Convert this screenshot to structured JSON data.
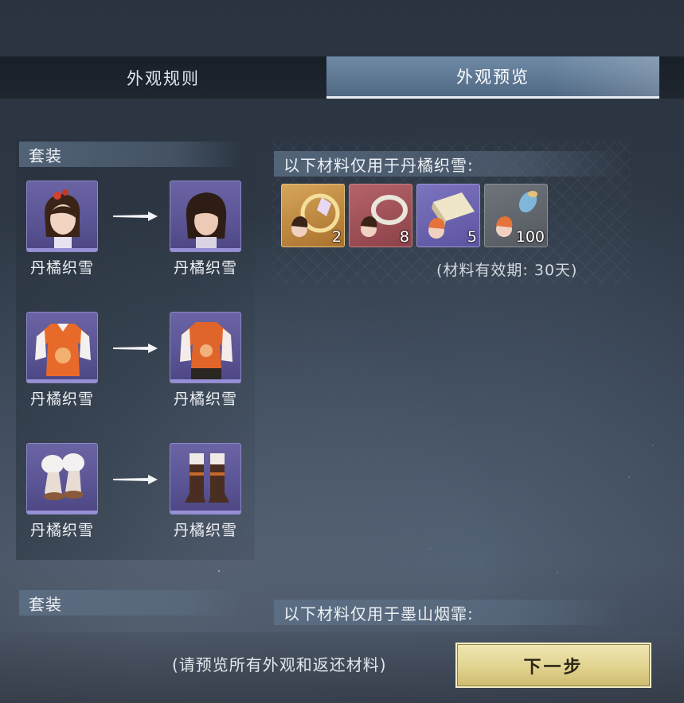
{
  "tabs": [
    {
      "label": "外观规则",
      "active": false
    },
    {
      "label": "外观预览",
      "active": true
    }
  ],
  "sections": [
    {
      "suit_header": "套装",
      "pairs": [
        {
          "from": {
            "icon": "hairstyle-icon",
            "label": "丹橘织雪"
          },
          "to": {
            "icon": "hairstyle-icon",
            "label": "丹橘织雪"
          }
        },
        {
          "from": {
            "icon": "outfit-icon",
            "label": "丹橘织雪"
          },
          "to": {
            "icon": "outfit-icon",
            "label": "丹橘织雪"
          }
        },
        {
          "from": {
            "icon": "boots-icon",
            "label": "丹橘织雪"
          },
          "to": {
            "icon": "boots-icon",
            "label": "丹橘织雪"
          }
        }
      ],
      "materials_header": "以下材料仅用于丹橘织雪:",
      "materials": [
        {
          "icon": "hairpin-ring-icon",
          "count": "2",
          "rarity": "gold"
        },
        {
          "icon": "ring-icon",
          "count": "8",
          "rarity": "red"
        },
        {
          "icon": "fabric-icon",
          "count": "5",
          "rarity": "purple"
        },
        {
          "icon": "thread-spool-icon",
          "count": "100",
          "rarity": "gray"
        }
      ],
      "validity": "(材料有效期: 30天)"
    },
    {
      "suit_header": "套装",
      "materials_header": "以下材料仅用于墨山烟霏:"
    }
  ],
  "footer": {
    "hint": "(请预览所有外观和返还材料)",
    "next_label": "下一步"
  },
  "colors": {
    "active_tab": "#5e7894",
    "card_purple": "#5a5494",
    "button_gold": "#e1d38f"
  }
}
